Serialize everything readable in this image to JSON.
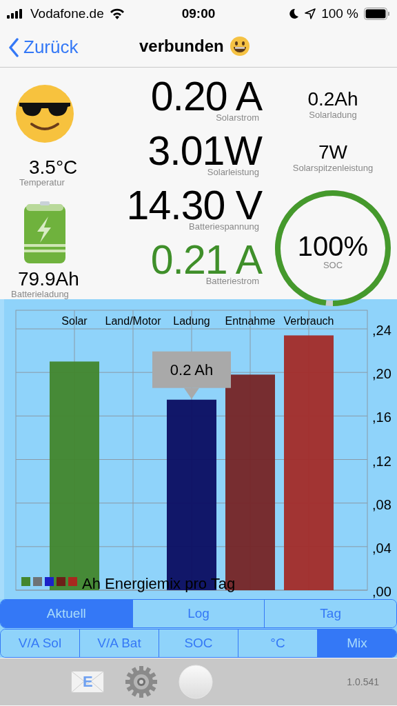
{
  "status_bar": {
    "carrier": "Vodafone.de",
    "time": "09:00",
    "battery": "100 %"
  },
  "nav": {
    "back": "Zurück",
    "title": "verbunden"
  },
  "readings": {
    "temperature": {
      "value": "3.5°C",
      "label": "Temperatur"
    },
    "battery_charge": {
      "value": "79.9Ah",
      "label": "Batterieladung"
    },
    "main": [
      {
        "value": "0.20 A",
        "label": "Solarstrom",
        "color": "#000000"
      },
      {
        "value": "3.01W",
        "label": "Solarleistung",
        "color": "#000000"
      },
      {
        "value": "14.30 V",
        "label": "Batteriespannung",
        "color": "#000000"
      },
      {
        "value": "0.21 A",
        "label": "Batteriestrom",
        "color": "#3f8f2a"
      }
    ],
    "side": [
      {
        "value": "0.2Ah",
        "label": "Solarladung"
      },
      {
        "value": "7W",
        "label": "Solarspitzenleistung"
      }
    ],
    "soc": {
      "value": "100%",
      "label": "SOC",
      "level": 0.98
    }
  },
  "chart": {
    "categories": [
      "Solar",
      "Land/Motor",
      "Ladung",
      "Entnahme",
      "Verbrauch"
    ],
    "y_axis_labels": [
      ",24",
      ",20",
      ",16",
      ",12",
      ",08",
      ",04",
      ",00"
    ],
    "tooltip": "0.2 Ah",
    "legend": {
      "label": "Ah Energiemix pro Tag",
      "swatches": [
        {
          "color": "#43862f"
        },
        {
          "color": "#6e7377"
        },
        {
          "color": "#1a22c8"
        },
        {
          "color": "#6b2017"
        },
        {
          "color": "#a8291f"
        }
      ]
    }
  },
  "tabs": {
    "primary": [
      {
        "label": "Aktuell",
        "selected": true
      },
      {
        "label": "Log",
        "selected": false
      },
      {
        "label": "Tag",
        "selected": false
      }
    ],
    "secondary": [
      {
        "label": "V/A Sol",
        "selected": false
      },
      {
        "label": "V/A Bat",
        "selected": false
      },
      {
        "label": "SOC",
        "selected": false
      },
      {
        "label": "°C",
        "selected": false
      },
      {
        "label": "Mix",
        "selected": true
      }
    ]
  },
  "toolbar": {
    "mail_letter": "E",
    "version": "1.0.541"
  }
}
